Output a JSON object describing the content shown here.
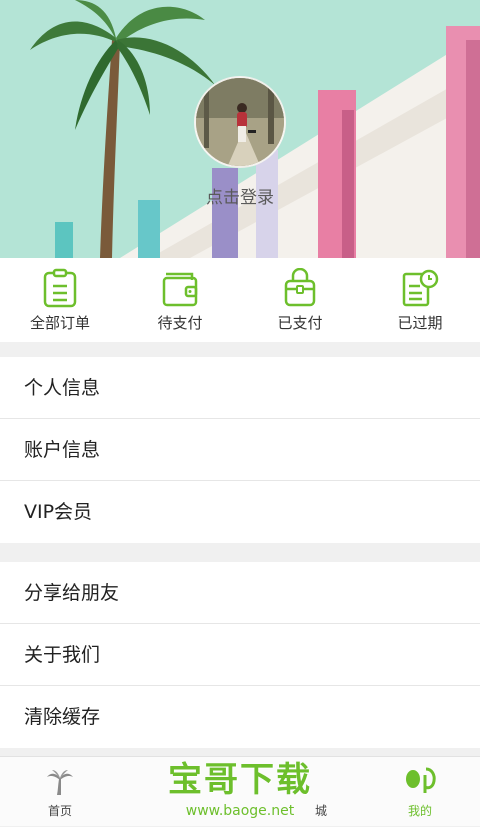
{
  "header": {
    "login_text": "点击登录"
  },
  "orders": [
    {
      "label": "全部订单",
      "icon": "clipboard-icon"
    },
    {
      "label": "待支付",
      "icon": "wallet-icon"
    },
    {
      "label": "已支付",
      "icon": "bag-icon"
    },
    {
      "label": "已过期",
      "icon": "expired-doc-icon"
    }
  ],
  "menu_group_1": [
    {
      "label": "个人信息"
    },
    {
      "label": "账户信息"
    },
    {
      "label": "VIP会员"
    }
  ],
  "menu_group_2": [
    {
      "label": "分享给朋友"
    },
    {
      "label": "关于我们"
    },
    {
      "label": "清除缓存"
    }
  ],
  "tabbar": {
    "home": {
      "label": "首页",
      "icon": "palm-tree-icon"
    },
    "mall": {
      "label": "城"
    },
    "mine": {
      "label": "我的",
      "icon": "profile-leaf-icon"
    }
  },
  "watermark": {
    "title": "宝哥下载",
    "url": "www.baoge.net"
  },
  "colors": {
    "accent": "#6dbf2c",
    "text": "#222222",
    "separator": "#f0f0f0"
  }
}
